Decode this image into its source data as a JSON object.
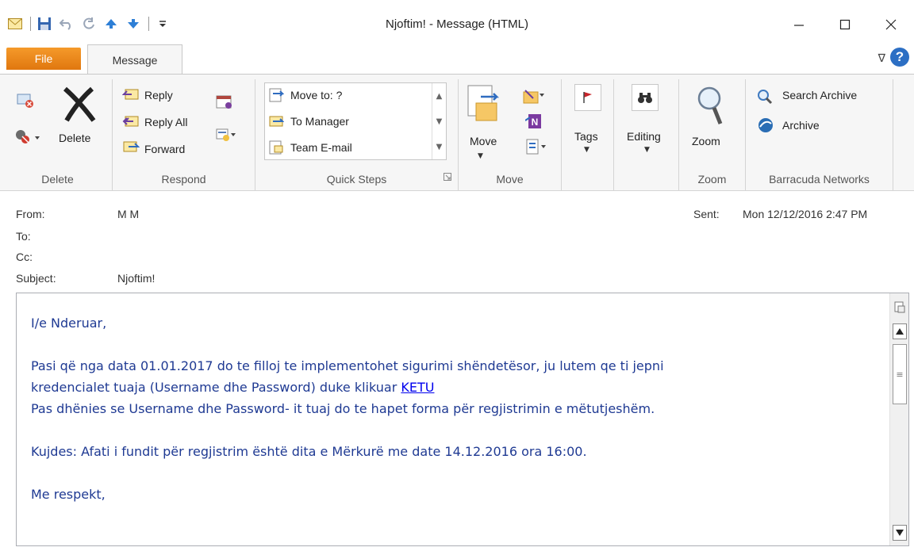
{
  "window": {
    "title": "Njoftim! - Message (HTML)",
    "qat_icons": [
      "mail-icon",
      "save-icon",
      "undo-icon",
      "redo-icon",
      "up-arrow-icon",
      "down-arrow-icon",
      "customize-icon"
    ]
  },
  "tabs": {
    "file": "File",
    "message": "Message"
  },
  "ribbon": {
    "delete_group": {
      "delete_label": "Delete",
      "group_label": "Delete"
    },
    "respond_group": {
      "reply": "Reply",
      "reply_all": "Reply All",
      "forward": "Forward",
      "group_label": "Respond"
    },
    "quick_steps_group": {
      "items": [
        "Move to: ?",
        "To Manager",
        "Team E-mail"
      ],
      "group_label": "Quick Steps"
    },
    "move_group": {
      "move_label": "Move",
      "group_label": "Move"
    },
    "tags_label": "Tags",
    "editing_label": "Editing",
    "zoom_group": {
      "zoom_label": "Zoom",
      "group_label": "Zoom"
    },
    "barracuda_group": {
      "search_archive": "Search Archive",
      "archive": "Archive",
      "group_label": "Barracuda Networks"
    }
  },
  "header": {
    "from_label": "From:",
    "from_value": "M M",
    "to_label": "To:",
    "cc_label": "Cc:",
    "subject_label": "Subject:",
    "subject_value": "Njoftim!",
    "sent_label": "Sent:",
    "sent_value": "Mon 12/12/2016 2:47 PM"
  },
  "body": {
    "greeting": "I/e Nderuar,",
    "p1_line1": "Pasi që nga data 01.01.2017 do te filloj te implementohet sigurimi shëndetësor, ju lutem qe ti jepni",
    "p1_line2": "kredencialet tuaja (Username dhe Password) duke klikuar ",
    "link": "KETU",
    "p1_line3": "Pas dhënies se Username dhe Password- it tuaj do te hapet forma për regjistrimin e mëtutjeshëm.",
    "p2": "Kujdes: Afati i fundit për regjistrim është dita e Mërkurë me date 14.12.2016 ora 16:00.",
    "closing": "Me respekt,"
  },
  "colors": {
    "file_tab": "#e8820f",
    "body_text": "#1f3a93",
    "link": "#0000ee"
  }
}
